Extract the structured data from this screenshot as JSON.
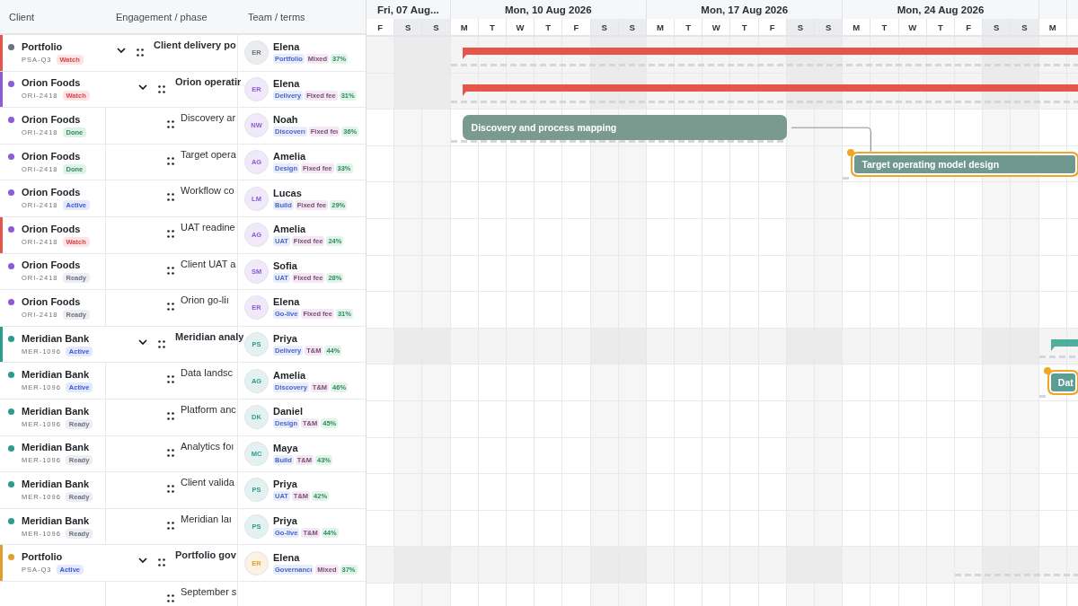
{
  "grid": {
    "columns": [
      "Client",
      "Engagement / phase",
      "Team / terms"
    ]
  },
  "timeline": {
    "weeks": [
      {
        "label": "Fri, 07 Aug...",
        "days": [
          {
            "letter": "F",
            "weekend": false
          },
          {
            "letter": "S",
            "weekend": true
          },
          {
            "letter": "S",
            "weekend": true
          }
        ]
      },
      {
        "label": "Mon, 10 Aug 2026",
        "days": [
          {
            "letter": "M",
            "weekend": false
          },
          {
            "letter": "T",
            "weekend": false
          },
          {
            "letter": "W",
            "weekend": false
          },
          {
            "letter": "T",
            "weekend": false
          },
          {
            "letter": "F",
            "weekend": false
          },
          {
            "letter": "S",
            "weekend": true
          },
          {
            "letter": "S",
            "weekend": true
          }
        ]
      },
      {
        "label": "Mon, 17 Aug 2026",
        "days": [
          {
            "letter": "M",
            "weekend": false
          },
          {
            "letter": "T",
            "weekend": false
          },
          {
            "letter": "W",
            "weekend": false
          },
          {
            "letter": "T",
            "weekend": false
          },
          {
            "letter": "F",
            "weekend": false
          },
          {
            "letter": "S",
            "weekend": true
          },
          {
            "letter": "S",
            "weekend": true
          }
        ]
      },
      {
        "label": "Mon, 24 Aug 2026",
        "days": [
          {
            "letter": "M",
            "weekend": false
          },
          {
            "letter": "T",
            "weekend": false
          },
          {
            "letter": "W",
            "weekend": false
          },
          {
            "letter": "T",
            "weekend": false
          },
          {
            "letter": "F",
            "weekend": false
          },
          {
            "letter": "S",
            "weekend": true
          },
          {
            "letter": "S",
            "weekend": true
          }
        ]
      },
      {
        "days": [
          {
            "letter": "M",
            "weekend": false
          }
        ]
      }
    ]
  },
  "rows": [
    {
      "client": {
        "name": "Portfolio",
        "code": "PSA-Q3",
        "status": {
          "label": "Watch",
          "kind": "watch"
        },
        "color": "#6b7280",
        "flagged": true
      },
      "engagement": "Client delivery po",
      "expanded": true,
      "team": {
        "initials": "ER",
        "name": "Elena",
        "phase": "Portfolio",
        "terms": "Mixed",
        "share": "37%"
      },
      "bar": {
        "kind": "summary",
        "color": "#e5554a"
      },
      "baseline": true,
      "children": [
        {
          "client": {
            "name": "Orion Foods",
            "code": "ORI-2418",
            "status": {
              "label": "Watch",
              "kind": "watch"
            },
            "color": "#8b5cd6",
            "flagged": false
          },
          "engagement": "Orion operatir",
          "expanded": true,
          "team": {
            "initials": "ER",
            "name": "Elena",
            "phase": "Delivery",
            "terms": "Fixed fee",
            "share": "31%"
          },
          "bar": {
            "kind": "summary",
            "color": "#e5554a"
          },
          "baseline": true,
          "children": [
            {
              "client": {
                "name": "Orion Foods",
                "code": "ORI-2418",
                "status": {
                  "label": "Done",
                  "kind": "done"
                },
                "color": "#8b5cd6",
                "flagged": false
              },
              "engagement": "Discovery ar",
              "team": {
                "initials": "NW",
                "name": "Noah",
                "phase": "Discoverı",
                "terms": "Fixed feı",
                "share": "36%"
              },
              "bar": {
                "kind": "task",
                "label": "Discovery and process mapping",
                "color": "#7a9a90",
                "selected": false
              },
              "baseline": true
            },
            {
              "client": {
                "name": "Orion Foods",
                "code": "ORI-2418",
                "status": {
                  "label": "Done",
                  "kind": "done"
                },
                "color": "#8b5cd6",
                "flagged": false
              },
              "engagement": "Target opera",
              "team": {
                "initials": "AG",
                "name": "Amelia",
                "phase": "Design",
                "terms": "Fixed fee",
                "share": "33%"
              },
              "bar": {
                "kind": "task",
                "label": "Target operating model design",
                "color": "#6f9890",
                "selected": true,
                "linked": true
              },
              "baseline": true
            },
            {
              "client": {
                "name": "Orion Foods",
                "code": "ORI-2418",
                "status": {
                  "label": "Active",
                  "kind": "active"
                },
                "color": "#8b5cd6",
                "flagged": false
              },
              "engagement": "Workflow co",
              "team": {
                "initials": "LM",
                "name": "Lucas",
                "phase": "Build",
                "terms": "Fixed fee",
                "share": "29%"
              }
            },
            {
              "client": {
                "name": "Orion Foods",
                "code": "ORI-2418",
                "status": {
                  "label": "Watch",
                  "kind": "watch"
                },
                "color": "#8b5cd6",
                "flagged": true
              },
              "engagement": "UAT readine",
              "team": {
                "initials": "AG",
                "name": "Amelia",
                "phase": "UAT",
                "terms": "Fixed fee",
                "share": "24%"
              }
            },
            {
              "client": {
                "name": "Orion Foods",
                "code": "ORI-2418",
                "status": {
                  "label": "Ready",
                  "kind": "ready"
                },
                "color": "#8b5cd6",
                "flagged": false
              },
              "engagement": "Client UAT a",
              "team": {
                "initials": "SM",
                "name": "Sofia",
                "phase": "UAT",
                "terms": "Fixed fee",
                "share": "28%"
              }
            },
            {
              "client": {
                "name": "Orion Foods",
                "code": "ORI-2418",
                "status": {
                  "label": "Ready",
                  "kind": "ready"
                },
                "color": "#8b5cd6",
                "flagged": false
              },
              "engagement": "Orion go-liı",
              "team": {
                "initials": "ER",
                "name": "Elena",
                "phase": "Go-live",
                "terms": "Fixed fee",
                "share": "31%"
              }
            }
          ]
        },
        {
          "client": {
            "name": "Meridian Bank",
            "code": "MER-1096",
            "status": {
              "label": "Active",
              "kind": "active"
            },
            "color": "#2a9d8f",
            "flagged": false
          },
          "engagement": "Meridian analy",
          "expanded": true,
          "team": {
            "initials": "PS",
            "name": "Priya",
            "phase": "Delivery",
            "terms": "T&M",
            "share": "44%"
          },
          "bar": {
            "kind": "summary",
            "color": "#4fae9c"
          },
          "baseline": true,
          "children": [
            {
              "client": {
                "name": "Meridian Bank",
                "code": "MER-1096",
                "status": {
                  "label": "Active",
                  "kind": "active"
                },
                "color": "#2a9d8f",
                "flagged": false
              },
              "engagement": "Data landsc",
              "team": {
                "initials": "AG",
                "name": "Amelia",
                "phase": "Discovery",
                "terms": "T&M",
                "share": "46%"
              },
              "bar": {
                "kind": "task",
                "label": "Dat",
                "color": "#5a9e94",
                "selected": true
              },
              "baseline": true
            },
            {
              "client": {
                "name": "Meridian Bank",
                "code": "MER-1096",
                "status": {
                  "label": "Ready",
                  "kind": "ready"
                },
                "color": "#2a9d8f",
                "flagged": false
              },
              "engagement": "Platform anc",
              "team": {
                "initials": "DK",
                "name": "Daniel",
                "phase": "Design",
                "terms": "T&M",
                "share": "45%"
              }
            },
            {
              "client": {
                "name": "Meridian Bank",
                "code": "MER-1096",
                "status": {
                  "label": "Ready",
                  "kind": "ready"
                },
                "color": "#2a9d8f",
                "flagged": false
              },
              "engagement": "Analytics foı",
              "team": {
                "initials": "MC",
                "name": "Maya",
                "phase": "Build",
                "terms": "T&M",
                "share": "43%"
              }
            },
            {
              "client": {
                "name": "Meridian Bank",
                "code": "MER-1096",
                "status": {
                  "label": "Ready",
                  "kind": "ready"
                },
                "color": "#2a9d8f",
                "flagged": false
              },
              "engagement": "Client valida",
              "team": {
                "initials": "PS",
                "name": "Priya",
                "phase": "UAT",
                "terms": "T&M",
                "share": "42%"
              }
            },
            {
              "client": {
                "name": "Meridian Bank",
                "code": "MER-1096",
                "status": {
                  "label": "Ready",
                  "kind": "ready"
                },
                "color": "#2a9d8f",
                "flagged": false
              },
              "engagement": "Meridian laı",
              "team": {
                "initials": "PS",
                "name": "Priya",
                "phase": "Go-live",
                "terms": "T&M",
                "share": "44%"
              }
            }
          ]
        },
        {
          "client": {
            "name": "Portfolio",
            "code": "PSA-Q3",
            "status": {
              "label": "Active",
              "kind": "active"
            },
            "color": "#e0a030",
            "flagged": false
          },
          "engagement": "Portfolio gov",
          "expanded": true,
          "team": {
            "initials": "ER",
            "name": "Elena",
            "phase": "Governancı",
            "terms": "Mixed",
            "share": "37%"
          },
          "baseline": true,
          "children": [
            {
              "engagement": "September s"
            }
          ]
        }
      ]
    }
  ]
}
